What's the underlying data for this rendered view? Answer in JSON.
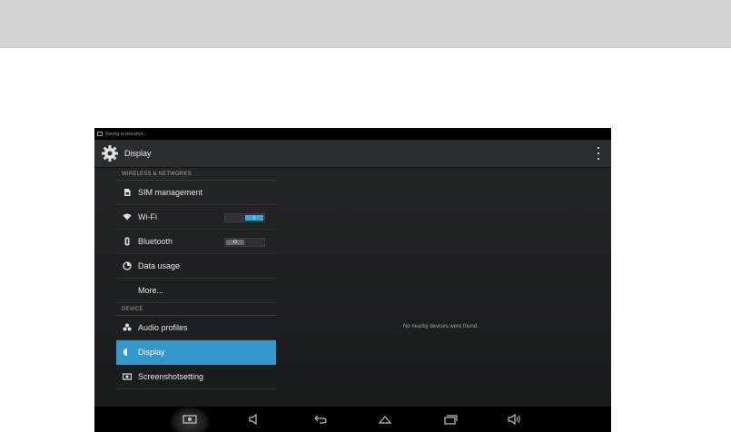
{
  "status_bar": {
    "notification_text": "Saving screenshot..."
  },
  "action_bar": {
    "title": "Display",
    "icon": "gear-icon",
    "overflow_icon": "overflow-menu-icon"
  },
  "settings": {
    "wireless_header": "WIRELESS & NETWORKS",
    "device_header": "DEVICE",
    "items": {
      "sim": {
        "label": "SIM management",
        "icon": "sim-icon"
      },
      "wifi": {
        "label": "Wi-Fi",
        "icon": "wifi-icon",
        "toggle_label": "I",
        "toggle_on": true
      },
      "bluetooth": {
        "label": "Bluetooth",
        "icon": "bluetooth-icon",
        "toggle_label": "O",
        "toggle_on": false
      },
      "data_usage": {
        "label": "Data usage",
        "icon": "data-usage-icon"
      },
      "more": {
        "label": "More..."
      },
      "audio": {
        "label": "Audio profiles",
        "icon": "audio-profiles-icon"
      },
      "display": {
        "label": "Display",
        "icon": "display-icon",
        "selected": true
      },
      "screenshot": {
        "label": "Screenshotsetting",
        "icon": "screenshot-icon"
      }
    }
  },
  "detail": {
    "message": "No nearby devices were found."
  },
  "nav_bar": {
    "buttons": [
      "screenshot-icon",
      "volume-down-icon",
      "back-icon",
      "home-icon",
      "recent-apps-icon",
      "volume-up-icon"
    ]
  },
  "colors": {
    "accent": "#3097c9",
    "toggle_on": "#33a9df",
    "top_band": "#d4d4d4"
  }
}
